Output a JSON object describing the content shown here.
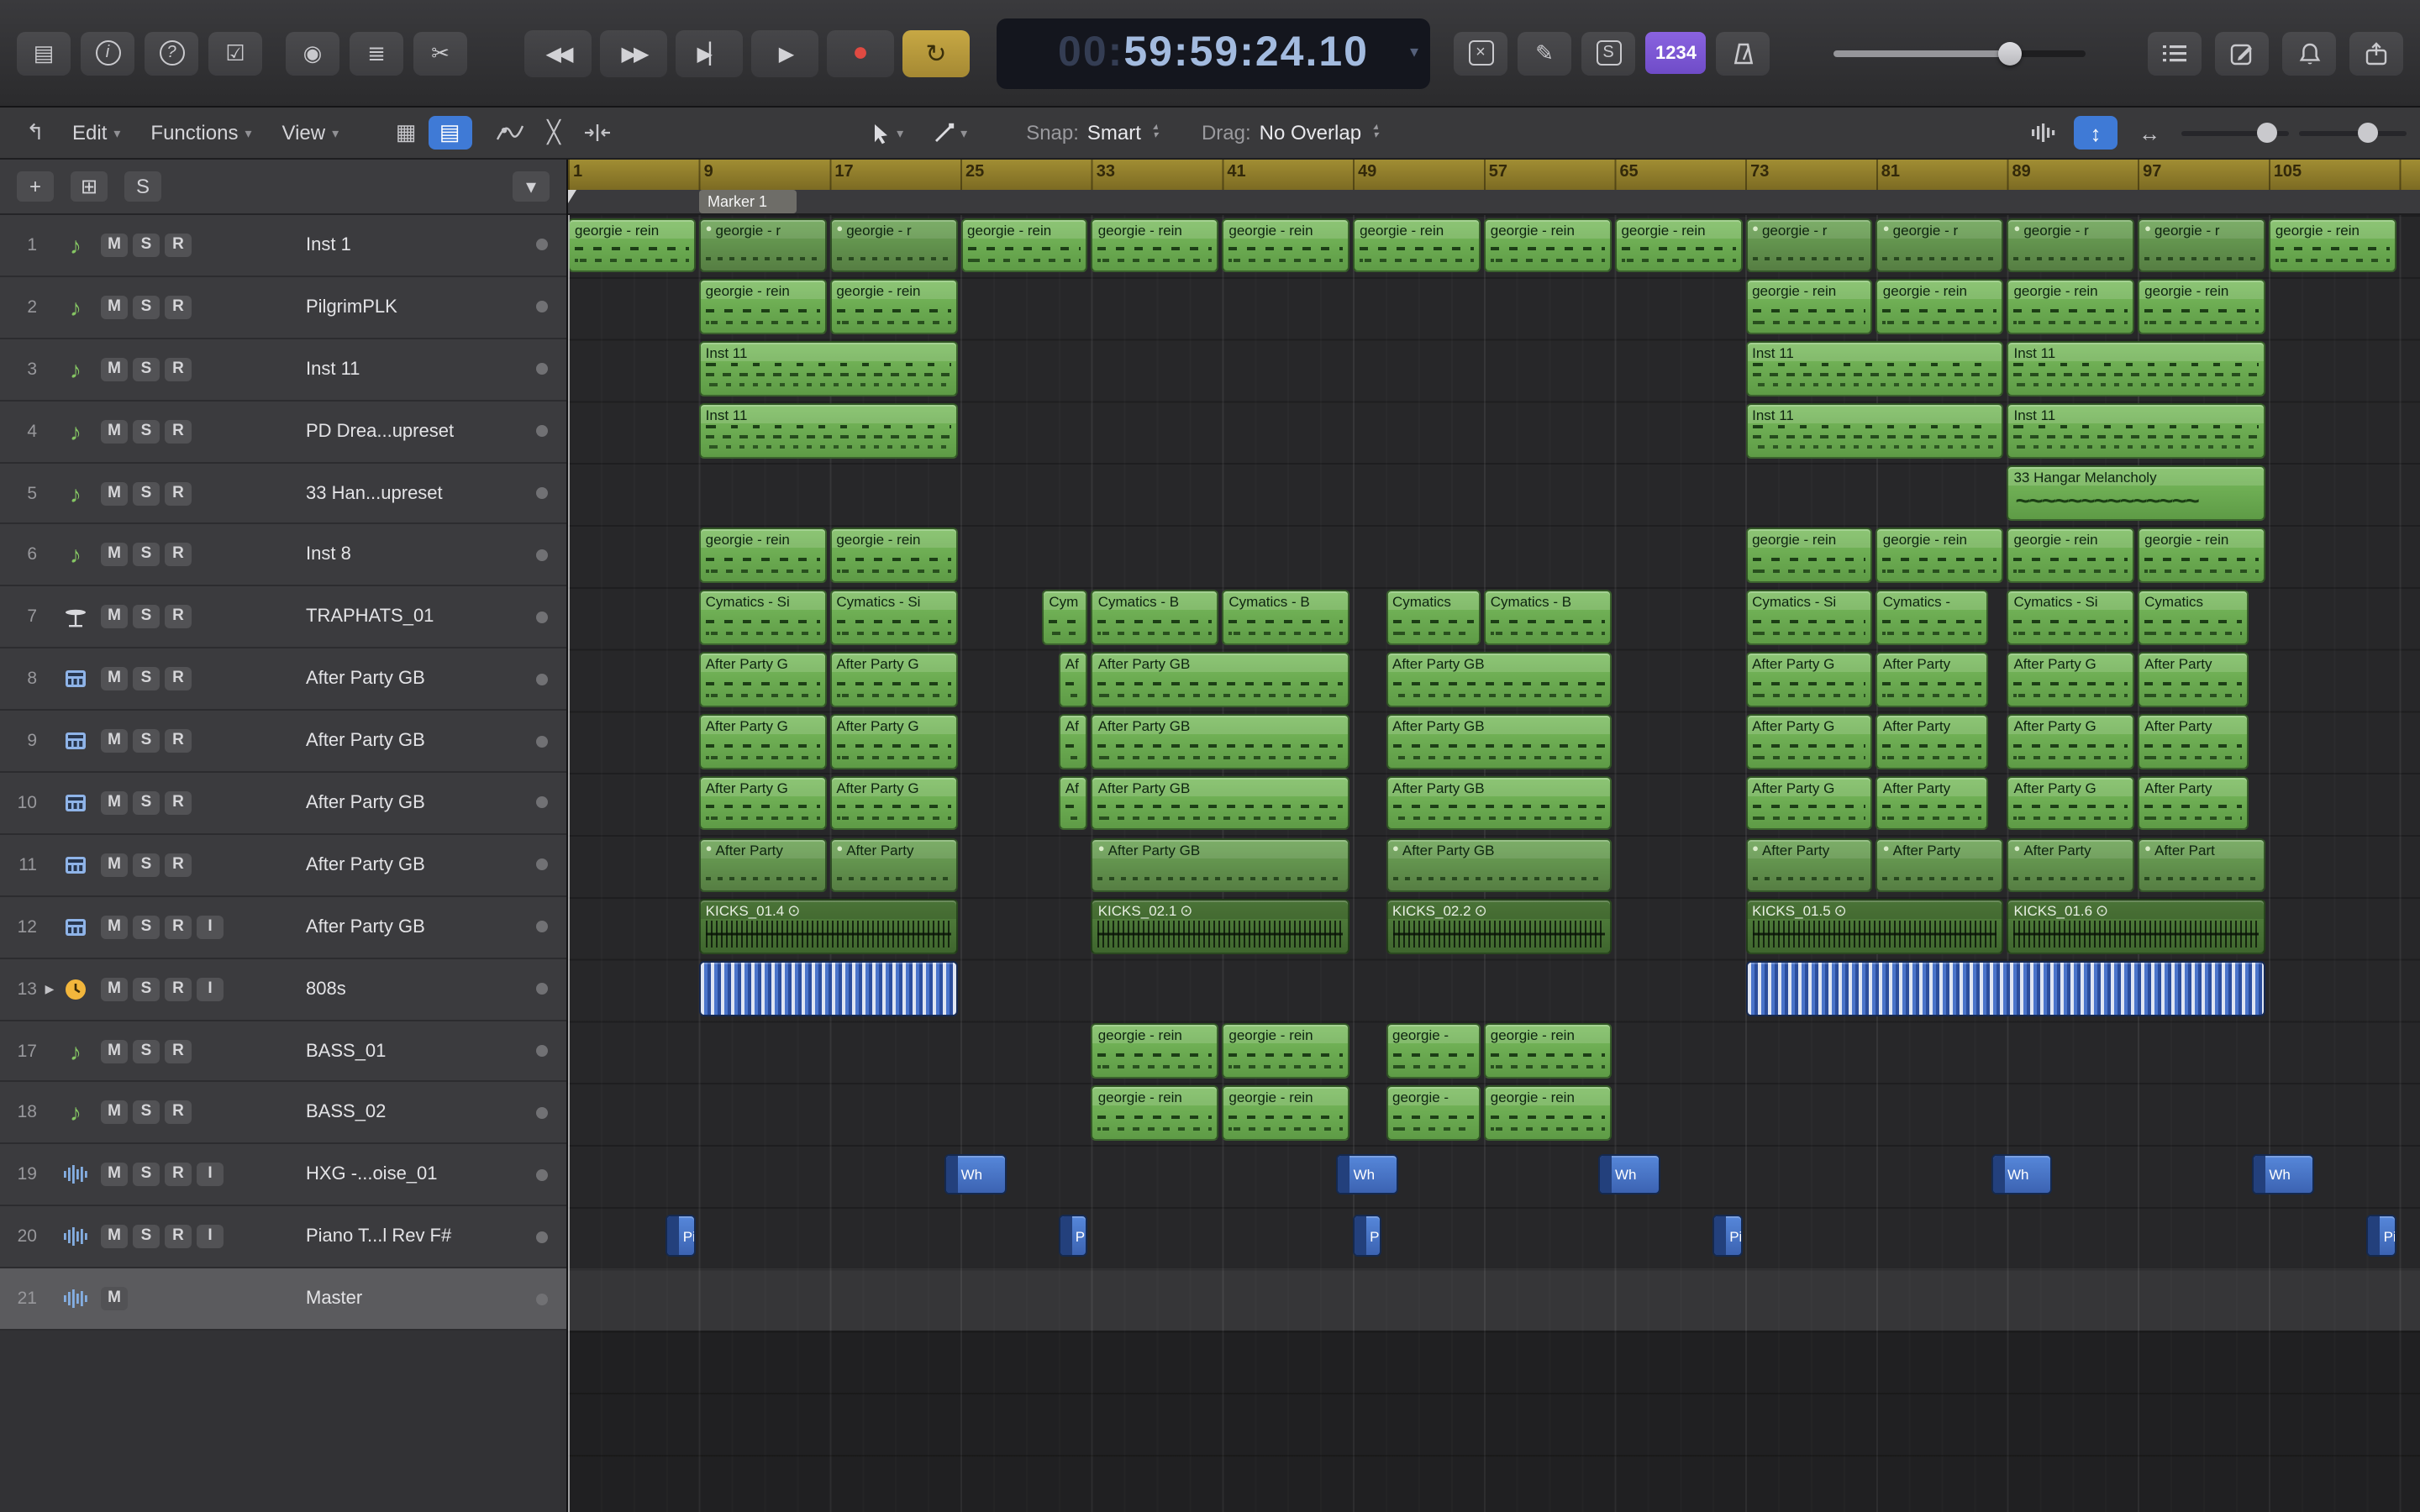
{
  "icons": {
    "library": "▤",
    "inspector": "i",
    "quick_help": "?",
    "toolbar_toggle": "☑",
    "smart_controls": "◉",
    "mixer": "≣",
    "editors": "✂",
    "rewind": "◀◀",
    "forward": "▶▶",
    "go_end": "▶▏",
    "play": "▶",
    "record": "●",
    "cycle": "↻",
    "chev": "▾",
    "chev_up": "▴",
    "replace": "×",
    "low_latency": "✎",
    "solo_box": "S",
    "back": "↰",
    "grid": "▦",
    "regions_view": "▤",
    "crossfade": "╳",
    "vertical_zoom": "↕",
    "horizontal_zoom": "↔",
    "list": "≣",
    "dup_track": "⊞",
    "plus": "+",
    "solo_track": "S",
    "track_menu": "▾",
    "tempo_follow": "⊙",
    "loop_bullet": "●"
  },
  "control_bar": {
    "lcd_prefix": "00:",
    "lcd_time": "59:59:24.10",
    "count_in": "1234"
  },
  "tools_bar": {
    "edit": "Edit",
    "functions": "Functions",
    "view": "View",
    "snap_label": "Snap:",
    "snap_value": "Smart",
    "drag_label": "Drag:",
    "drag_value": "No Overlap"
  },
  "ruler": {
    "numbers": [
      "1",
      "9",
      "17",
      "25",
      "33",
      "41",
      "49",
      "57",
      "65",
      "73",
      "81",
      "89",
      "97",
      "105"
    ],
    "marker": "Marker 1"
  },
  "tracks": [
    {
      "num": "1",
      "name": "Inst 1",
      "icon": "music-note",
      "buttons": [
        "M",
        "S",
        "R"
      ]
    },
    {
      "num": "2",
      "name": "PilgrimPLK",
      "icon": "music-note",
      "buttons": [
        "M",
        "S",
        "R"
      ]
    },
    {
      "num": "3",
      "name": "Inst 11",
      "icon": "music-note",
      "buttons": [
        "M",
        "S",
        "R"
      ]
    },
    {
      "num": "4",
      "name": "PD Drea...upreset",
      "icon": "music-note",
      "buttons": [
        "M",
        "S",
        "R"
      ]
    },
    {
      "num": "5",
      "name": "33 Han...upreset",
      "icon": "music-note",
      "buttons": [
        "M",
        "S",
        "R"
      ]
    },
    {
      "num": "6",
      "name": "Inst 8",
      "icon": "music-note",
      "buttons": [
        "M",
        "S",
        "R"
      ]
    },
    {
      "num": "7",
      "name": "TRAPHATS_01",
      "icon": "hi-hat",
      "buttons": [
        "M",
        "S",
        "R"
      ]
    },
    {
      "num": "8",
      "name": "After Party GB",
      "icon": "drum-machine",
      "buttons": [
        "M",
        "S",
        "R"
      ]
    },
    {
      "num": "9",
      "name": "After Party GB",
      "icon": "drum-machine",
      "buttons": [
        "M",
        "S",
        "R"
      ]
    },
    {
      "num": "10",
      "name": "After Party GB",
      "icon": "drum-machine",
      "buttons": [
        "M",
        "S",
        "R"
      ]
    },
    {
      "num": "11",
      "name": "After Party GB",
      "icon": "drum-machine",
      "buttons": [
        "M",
        "S",
        "R"
      ]
    },
    {
      "num": "12",
      "name": "After Party GB",
      "icon": "drum-machine",
      "buttons": [
        "M",
        "S",
        "R",
        "I"
      ]
    },
    {
      "num": "13",
      "name": "808s",
      "icon": "clock",
      "buttons": [
        "M",
        "S",
        "R",
        "I"
      ],
      "disclosure": true
    },
    {
      "num": "17",
      "name": "BASS_01",
      "icon": "music-note",
      "buttons": [
        "M",
        "S",
        "R"
      ]
    },
    {
      "num": "18",
      "name": "BASS_02",
      "icon": "music-note",
      "buttons": [
        "M",
        "S",
        "R"
      ]
    },
    {
      "num": "19",
      "name": "HXG -...oise_01",
      "icon": "waveform",
      "buttons": [
        "M",
        "S",
        "R",
        "I"
      ]
    },
    {
      "num": "20",
      "name": "Piano T...l Rev F#",
      "icon": "waveform",
      "buttons": [
        "M",
        "S",
        "R",
        "I"
      ]
    },
    {
      "num": "21",
      "name": "Master",
      "icon": "waveform",
      "buttons": [
        "M"
      ],
      "selected": true
    }
  ],
  "regions": [
    {
      "t": "1",
      "s": 1,
      "l": 8,
      "n": "georgie - rein",
      "y": "midi"
    },
    {
      "t": "1",
      "s": 9,
      "l": 8,
      "n": "georgie - r",
      "y": "loop"
    },
    {
      "t": "1",
      "s": 17,
      "l": 8,
      "n": "georgie - r",
      "y": "loop"
    },
    {
      "t": "1",
      "s": 25,
      "l": 8,
      "n": "georgie - rein",
      "y": "midi"
    },
    {
      "t": "1",
      "s": 33,
      "l": 8,
      "n": "georgie - rein",
      "y": "midi"
    },
    {
      "t": "1",
      "s": 41,
      "l": 8,
      "n": "georgie - rein",
      "y": "midi"
    },
    {
      "t": "1",
      "s": 49,
      "l": 8,
      "n": "georgie - rein",
      "y": "midi"
    },
    {
      "t": "1",
      "s": 57,
      "l": 8,
      "n": "georgie - rein",
      "y": "midi"
    },
    {
      "t": "1",
      "s": 65,
      "l": 8,
      "n": "georgie - rein",
      "y": "midi"
    },
    {
      "t": "1",
      "s": 73,
      "l": 8,
      "n": "georgie - r",
      "y": "loop"
    },
    {
      "t": "1",
      "s": 81,
      "l": 8,
      "n": "georgie - r",
      "y": "loop"
    },
    {
      "t": "1",
      "s": 89,
      "l": 8,
      "n": "georgie - r",
      "y": "loop"
    },
    {
      "t": "1",
      "s": 97,
      "l": 8,
      "n": "georgie - r",
      "y": "loop"
    },
    {
      "t": "1",
      "s": 105,
      "l": 8,
      "n": "georgie - rein",
      "y": "midi"
    },
    {
      "t": "2",
      "s": 9,
      "l": 8,
      "n": "georgie - rein",
      "y": "midi"
    },
    {
      "t": "2",
      "s": 17,
      "l": 8,
      "n": "georgie - rein",
      "y": "midi"
    },
    {
      "t": "2",
      "s": 73,
      "l": 8,
      "n": "georgie - rein",
      "y": "midi"
    },
    {
      "t": "2",
      "s": 81,
      "l": 8,
      "n": "georgie - rein",
      "y": "midi"
    },
    {
      "t": "2",
      "s": 89,
      "l": 8,
      "n": "georgie - rein",
      "y": "midi"
    },
    {
      "t": "2",
      "s": 97,
      "l": 8,
      "n": "georgie - rein",
      "y": "midi"
    },
    {
      "t": "3",
      "s": 9,
      "l": 16,
      "n": "Inst 11",
      "y": "notes"
    },
    {
      "t": "3",
      "s": 73,
      "l": 16,
      "n": "Inst 11",
      "y": "notes"
    },
    {
      "t": "3",
      "s": 89,
      "l": 16,
      "n": "Inst 11",
      "y": "notes"
    },
    {
      "t": "4",
      "s": 9,
      "l": 16,
      "n": "Inst 11",
      "y": "notes"
    },
    {
      "t": "4",
      "s": 73,
      "l": 16,
      "n": "Inst 11",
      "y": "notes"
    },
    {
      "t": "4",
      "s": 89,
      "l": 16,
      "n": "Inst 11",
      "y": "notes"
    },
    {
      "t": "5",
      "s": 89,
      "l": 16,
      "n": "33 Hangar Melancholy",
      "y": "wavegreen"
    },
    {
      "t": "6",
      "s": 9,
      "l": 8,
      "n": "georgie - rein",
      "y": "midi"
    },
    {
      "t": "6",
      "s": 17,
      "l": 8,
      "n": "georgie - rein",
      "y": "midi"
    },
    {
      "t": "6",
      "s": 73,
      "l": 8,
      "n": "georgie - rein",
      "y": "midi"
    },
    {
      "t": "6",
      "s": 81,
      "l": 8,
      "n": "georgie - rein",
      "y": "midi"
    },
    {
      "t": "6",
      "s": 89,
      "l": 8,
      "n": "georgie - rein",
      "y": "midi"
    },
    {
      "t": "6",
      "s": 97,
      "l": 8,
      "n": "georgie - rein",
      "y": "midi"
    },
    {
      "t": "7",
      "s": 9,
      "l": 8,
      "n": "Cymatics - Si",
      "y": "midi"
    },
    {
      "t": "7",
      "s": 17,
      "l": 8,
      "n": "Cymatics - Si",
      "y": "midi"
    },
    {
      "t": "7",
      "s": 30,
      "l": 3,
      "n": "Cym",
      "y": "midi"
    },
    {
      "t": "7",
      "s": 33,
      "l": 8,
      "n": "Cymatics - B",
      "y": "midi"
    },
    {
      "t": "7",
      "s": 41,
      "l": 8,
      "n": "Cymatics - B",
      "y": "midi"
    },
    {
      "t": "7",
      "s": 51,
      "l": 6,
      "n": "Cymatics",
      "y": "midi"
    },
    {
      "t": "7",
      "s": 57,
      "l": 8,
      "n": "Cymatics - B",
      "y": "midi"
    },
    {
      "t": "7",
      "s": 73,
      "l": 8,
      "n": "Cymatics - Si",
      "y": "midi"
    },
    {
      "t": "7",
      "s": 81,
      "l": 7,
      "n": "Cymatics -",
      "y": "midi"
    },
    {
      "t": "7",
      "s": 89,
      "l": 8,
      "n": "Cymatics - Si",
      "y": "midi"
    },
    {
      "t": "7",
      "s": 97,
      "l": 7,
      "n": "Cymatics",
      "y": "midi"
    },
    {
      "t": "8",
      "s": 9,
      "l": 8,
      "n": "After Party G",
      "y": "midi"
    },
    {
      "t": "8",
      "s": 17,
      "l": 8,
      "n": "After Party G",
      "y": "midi"
    },
    {
      "t": "8",
      "s": 31,
      "l": 2,
      "n": "Af",
      "y": "midi"
    },
    {
      "t": "8",
      "s": 33,
      "l": 16,
      "n": "After Party GB",
      "y": "midi"
    },
    {
      "t": "8",
      "s": 51,
      "l": 14,
      "n": "After Party GB",
      "y": "midi"
    },
    {
      "t": "8",
      "s": 73,
      "l": 8,
      "n": "After Party G",
      "y": "midi"
    },
    {
      "t": "8",
      "s": 81,
      "l": 7,
      "n": "After Party",
      "y": "midi"
    },
    {
      "t": "8",
      "s": 89,
      "l": 8,
      "n": "After Party G",
      "y": "midi"
    },
    {
      "t": "8",
      "s": 97,
      "l": 7,
      "n": "After Party",
      "y": "midi"
    },
    {
      "t": "9",
      "s": 9,
      "l": 8,
      "n": "After Party G",
      "y": "midi"
    },
    {
      "t": "9",
      "s": 17,
      "l": 8,
      "n": "After Party G",
      "y": "midi"
    },
    {
      "t": "9",
      "s": 31,
      "l": 2,
      "n": "Af",
      "y": "midi"
    },
    {
      "t": "9",
      "s": 33,
      "l": 16,
      "n": "After Party GB",
      "y": "midi"
    },
    {
      "t": "9",
      "s": 51,
      "l": 14,
      "n": "After Party GB",
      "y": "midi"
    },
    {
      "t": "9",
      "s": 73,
      "l": 8,
      "n": "After Party G",
      "y": "midi"
    },
    {
      "t": "9",
      "s": 81,
      "l": 7,
      "n": "After Party",
      "y": "midi"
    },
    {
      "t": "9",
      "s": 89,
      "l": 8,
      "n": "After Party G",
      "y": "midi"
    },
    {
      "t": "9",
      "s": 97,
      "l": 7,
      "n": "After Party",
      "y": "midi"
    },
    {
      "t": "10",
      "s": 9,
      "l": 8,
      "n": "After Party G",
      "y": "midi"
    },
    {
      "t": "10",
      "s": 17,
      "l": 8,
      "n": "After Party G",
      "y": "midi"
    },
    {
      "t": "10",
      "s": 31,
      "l": 2,
      "n": "Af",
      "y": "midi"
    },
    {
      "t": "10",
      "s": 33,
      "l": 16,
      "n": "After Party GB",
      "y": "midi"
    },
    {
      "t": "10",
      "s": 51,
      "l": 14,
      "n": "After Party GB",
      "y": "midi"
    },
    {
      "t": "10",
      "s": 73,
      "l": 8,
      "n": "After Party G",
      "y": "midi"
    },
    {
      "t": "10",
      "s": 81,
      "l": 7,
      "n": "After Party",
      "y": "midi"
    },
    {
      "t": "10",
      "s": 89,
      "l": 8,
      "n": "After Party G",
      "y": "midi"
    },
    {
      "t": "10",
      "s": 97,
      "l": 7,
      "n": "After Party",
      "y": "midi"
    },
    {
      "t": "11",
      "s": 9,
      "l": 8,
      "n": "After Party",
      "y": "loop"
    },
    {
      "t": "11",
      "s": 17,
      "l": 8,
      "n": "After Party",
      "y": "loop"
    },
    {
      "t": "11",
      "s": 33,
      "l": 16,
      "n": "After Party GB",
      "y": "loop"
    },
    {
      "t": "11",
      "s": 51,
      "l": 14,
      "n": "After Party GB",
      "y": "loop"
    },
    {
      "t": "11",
      "s": 73,
      "l": 8,
      "n": "After Party",
      "y": "loop"
    },
    {
      "t": "11",
      "s": 81,
      "l": 8,
      "n": "After Party",
      "y": "loop"
    },
    {
      "t": "11",
      "s": 89,
      "l": 8,
      "n": "After Party",
      "y": "loop"
    },
    {
      "t": "11",
      "s": 97,
      "l": 8,
      "n": "After Part",
      "y": "loop"
    },
    {
      "t": "12",
      "s": 9,
      "l": 16,
      "n": "KICKS_01.4",
      "y": "audio"
    },
    {
      "t": "12",
      "s": 33,
      "l": 16,
      "n": "KICKS_02.1",
      "y": "audio"
    },
    {
      "t": "12",
      "s": 51,
      "l": 14,
      "n": "KICKS_02.2",
      "y": "audio"
    },
    {
      "t": "12",
      "s": 73,
      "l": 16,
      "n": "KICKS_01.5",
      "y": "audio"
    },
    {
      "t": "12",
      "s": 89,
      "l": 16,
      "n": "KICKS_01.6",
      "y": "audio"
    },
    {
      "t": "13",
      "s": 9,
      "l": 16,
      "n": "",
      "y": "dense"
    },
    {
      "t": "13",
      "s": 73,
      "l": 32,
      "n": "",
      "y": "dense"
    },
    {
      "t": "17",
      "s": 33,
      "l": 8,
      "n": "georgie - rein",
      "y": "midi"
    },
    {
      "t": "17",
      "s": 41,
      "l": 8,
      "n": "georgie - rein",
      "y": "midi"
    },
    {
      "t": "17",
      "s": 51,
      "l": 6,
      "n": "georgie -",
      "y": "midi"
    },
    {
      "t": "17",
      "s": 57,
      "l": 8,
      "n": "georgie - rein",
      "y": "midi"
    },
    {
      "t": "18",
      "s": 33,
      "l": 8,
      "n": "georgie - rein",
      "y": "midi"
    },
    {
      "t": "18",
      "s": 41,
      "l": 8,
      "n": "georgie - rein",
      "y": "midi"
    },
    {
      "t": "18",
      "s": 51,
      "l": 6,
      "n": "georgie -",
      "y": "midi"
    },
    {
      "t": "18",
      "s": 57,
      "l": 8,
      "n": "georgie - rein",
      "y": "midi"
    },
    {
      "t": "19",
      "s": 24,
      "l": 4,
      "n": "Wh",
      "y": "blue"
    },
    {
      "t": "19",
      "s": 48,
      "l": 4,
      "n": "Wh",
      "y": "blue"
    },
    {
      "t": "19",
      "s": 64,
      "l": 4,
      "n": "Wh",
      "y": "blue"
    },
    {
      "t": "19",
      "s": 88,
      "l": 4,
      "n": "Wh",
      "y": "blue"
    },
    {
      "t": "19",
      "s": 104,
      "l": 4,
      "n": "Wh",
      "y": "blue"
    },
    {
      "t": "20",
      "s": 7,
      "l": 2,
      "n": "Pi",
      "y": "blue"
    },
    {
      "t": "20",
      "s": 31,
      "l": 2,
      "n": "Pi",
      "y": "blue"
    },
    {
      "t": "20",
      "s": 49,
      "l": 2,
      "n": "Pi",
      "y": "blue"
    },
    {
      "t": "20",
      "s": 71,
      "l": 2,
      "n": "Pi",
      "y": "blue"
    },
    {
      "t": "20",
      "s": 111,
      "l": 2,
      "n": "Pi",
      "y": "blue"
    }
  ]
}
